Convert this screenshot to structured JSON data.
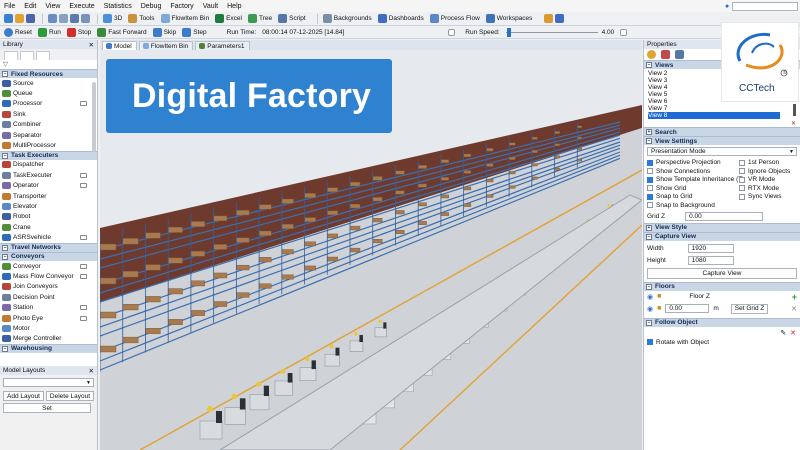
{
  "menu": [
    "File",
    "Edit",
    "View",
    "Execute",
    "Statistics",
    "Debug",
    "Factory",
    "Vault",
    "Help"
  ],
  "toolbar1": {
    "view3d": "3D",
    "tools": "Tools",
    "flowitem_bin": "FlowItem Bin",
    "excel": "Excel",
    "tree": "Tree",
    "script": "Script",
    "backgrounds": "Backgrounds",
    "dashboards": "Dashboards",
    "process_flow": "Process Flow",
    "workspaces": "Workspaces"
  },
  "toolbar2": {
    "reset": "Reset",
    "run": "Run",
    "stop": "Stop",
    "fast_forward": "Fast Forward",
    "skip": "Skip",
    "step": "Step",
    "run_time_label": "Run Time:",
    "run_time_value": "08:00:14  07-12-2025  [14.84]",
    "run_speed_label": "Run Speed:",
    "run_speed_value": "4.00"
  },
  "library": {
    "title": "Library",
    "categories": [
      {
        "name": "Fixed Resources",
        "items": [
          "Source",
          "Queue",
          "Processor",
          "Sink",
          "Combiner",
          "Separator",
          "MultiProcessor"
        ]
      },
      {
        "name": "Task Executers",
        "items": [
          "Dispatcher",
          "TaskExecuter",
          "Operator",
          "Transporter",
          "Elevator",
          "Robot",
          "Crane",
          "ASRSvehicle"
        ]
      },
      {
        "name": "Travel Networks",
        "items": []
      },
      {
        "name": "Conveyors",
        "items": [
          "Conveyor",
          "Mass Flow Conveyor",
          "Join Conveyors",
          "Decision Point",
          "Station",
          "Photo Eye",
          "Motor",
          "Merge Controller"
        ]
      },
      {
        "name": "Warehousing",
        "items": []
      }
    ]
  },
  "model_layouts": {
    "title": "Model Layouts",
    "add_layout": "Add Layout",
    "delete_layout": "Delete Layout",
    "set": "Set"
  },
  "doc_tabs": [
    "Model",
    "FlowItem Bin",
    "Parameters1"
  ],
  "viewport": {
    "overlay_title": "Digital Factory"
  },
  "properties": {
    "title": "Properties",
    "views_section": "Views",
    "views": [
      "View 2",
      "View 3",
      "View 4",
      "View 5",
      "View 6",
      "View 7",
      "View 8"
    ],
    "selected_view": "View 8",
    "search_section": "Search",
    "view_settings_section": "View Settings",
    "presentation_mode": "Presentation Mode",
    "checkboxes": [
      {
        "label": "Perspective Projection",
        "checked": true
      },
      {
        "label": "1st Person",
        "checked": false
      },
      {
        "label": "Show Connections",
        "checked": false
      },
      {
        "label": "Ignore Objects",
        "checked": false
      },
      {
        "label": "Show Template Inheritance (T)",
        "checked": true
      },
      {
        "label": "VR Mode",
        "checked": false
      },
      {
        "label": "Show Grid",
        "checked": false
      },
      {
        "label": "RTX Mode",
        "checked": false
      },
      {
        "label": "Snap to Grid",
        "checked": true
      },
      {
        "label": "Sync Views",
        "checked": false
      },
      {
        "label": "Snap to Background",
        "checked": false
      }
    ],
    "grid_z_label": "Grid Z",
    "grid_z_value": "0.00",
    "view_style_section": "View Style",
    "capture_view_section": "Capture View",
    "width_label": "Width",
    "width_value": "1920",
    "height_label": "Height",
    "height_value": "1080",
    "capture_view_button": "Capture View",
    "floors_section": "Floors",
    "floor_name": "Floor Z",
    "floor_value": "0.00",
    "floor_unit": "m",
    "set_grid_z": "Set Grid Z",
    "follow_object_section": "Follow Object",
    "rotate_with_object": "Rotate with Object"
  },
  "logo": {
    "text": "CCTech",
    "registered": "®"
  },
  "colors": {
    "accent": "#2f82d0",
    "selection": "#1f6bd6",
    "floor_lines": "#e2a33a"
  }
}
